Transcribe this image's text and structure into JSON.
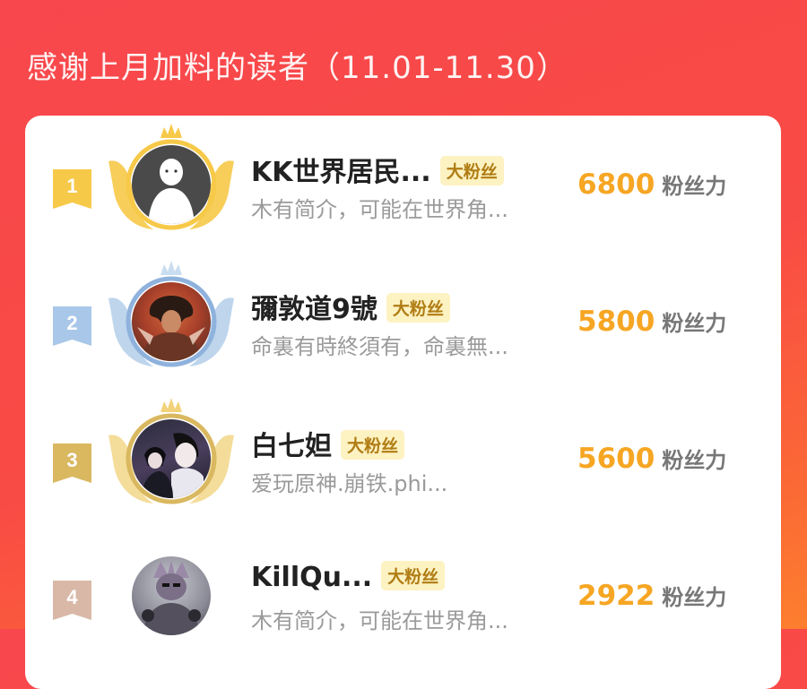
{
  "header": {
    "title": "感谢上月加料的读者（11.01-11.30）"
  },
  "fan_tag": "大粉丝",
  "score_unit": "粉丝力",
  "leaderboard": [
    {
      "rank": "1",
      "name": "KK世界居民...",
      "bio": "木有简介，可能在世界角...",
      "score": "6800",
      "medal": "gold",
      "avatar": "default-avatar"
    },
    {
      "rank": "2",
      "name": "彌敦道9號",
      "bio": "命裏有時終須有，命裏無...",
      "score": "5800",
      "medal": "silver",
      "avatar": "photo-avatar"
    },
    {
      "rank": "3",
      "name": "白七妲",
      "bio": "爱玩原神.崩铁.phi...",
      "score": "5600",
      "medal": "bronze",
      "avatar": "anime-avatar"
    },
    {
      "rank": "4",
      "name": "KillQu...",
      "bio": "木有简介，可能在世界角...",
      "score": "2922",
      "medal": "none",
      "avatar": "character-avatar"
    }
  ],
  "colors": {
    "gold": "#f7c948",
    "silver": "#a9c7e8",
    "bronze": "#d9b860",
    "rank4": "#d9b8a7",
    "score": "#f6a623"
  }
}
